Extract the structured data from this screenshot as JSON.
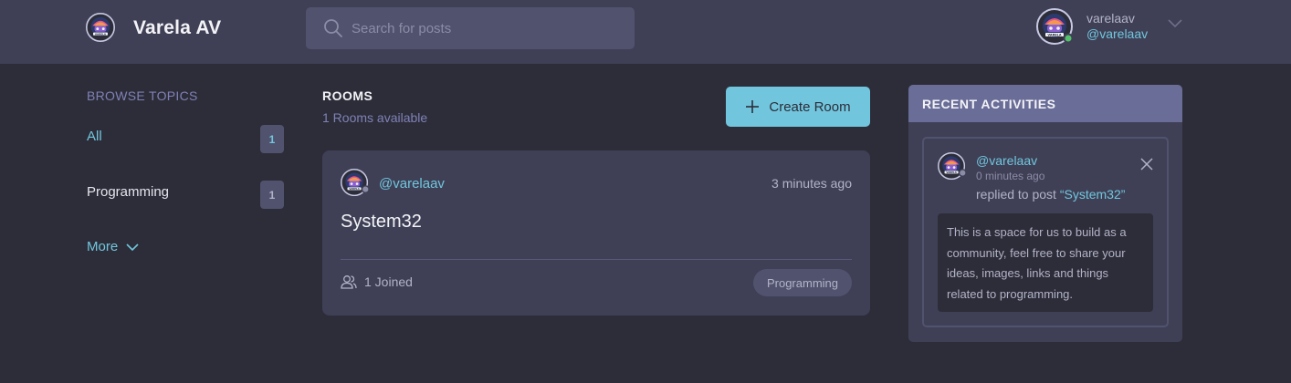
{
  "header": {
    "brand": "Varela AV",
    "search_placeholder": "Search for posts",
    "user": {
      "name": "varelaav",
      "handle": "@varelaav"
    }
  },
  "sidebar": {
    "title": "BROWSE TOPICS",
    "topics": [
      {
        "label": "All",
        "count": "1"
      },
      {
        "label": "Programming",
        "count": "1"
      }
    ],
    "more_label": "More"
  },
  "rooms": {
    "title": "ROOMS",
    "count_text": "1 Rooms available",
    "create_label": "Create Room",
    "items": [
      {
        "host": "@varelaav",
        "time": "3 minutes ago",
        "name": "System32",
        "joined": "1 Joined",
        "topic": "Programming"
      }
    ]
  },
  "activities": {
    "title": "RECENT ACTIVITIES",
    "items": [
      {
        "user": "@varelaav",
        "time": "0 minutes ago",
        "action_prefix": "replied to post ",
        "post_link": "“System32”",
        "message": "This is a space for us to build as a community, feel free to share your ideas, images, links and things related to programming."
      }
    ]
  },
  "colors": {
    "background": "#2d2d39",
    "surface": "#3f4056",
    "accent": "#71c6dd",
    "muted": "#7f81b6",
    "activity_header": "#696d97"
  },
  "icons": {
    "logo": "varela-logo-icon",
    "search": "search-icon",
    "chevron": "chevron-down-icon",
    "plus": "plus-icon",
    "users": "users-icon",
    "close": "close-icon"
  }
}
